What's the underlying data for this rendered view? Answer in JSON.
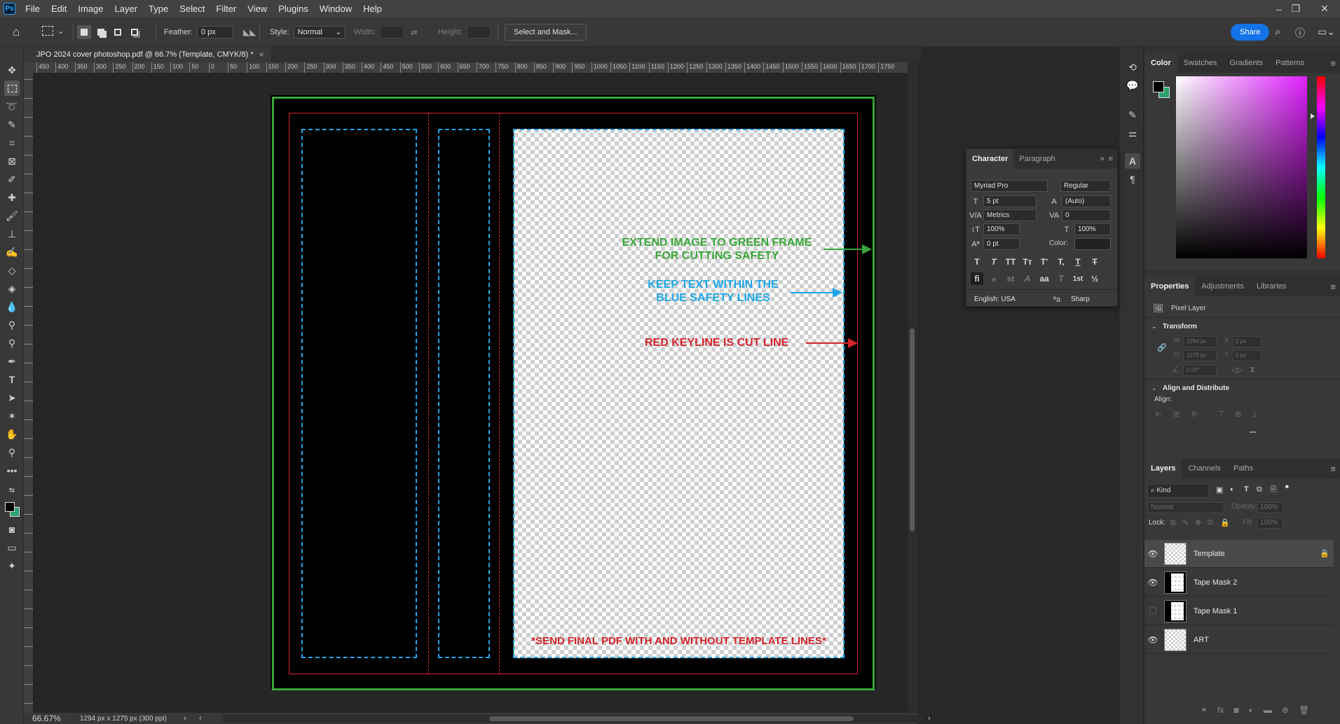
{
  "menubar": {
    "logo": "Ps",
    "items": [
      "File",
      "Edit",
      "Image",
      "Layer",
      "Type",
      "Select",
      "Filter",
      "View",
      "Plugins",
      "Window",
      "Help"
    ],
    "minimize": "–",
    "restore": "❐",
    "close": "✕"
  },
  "options": {
    "feather_label": "Feather:",
    "feather_value": "0 px",
    "style_label": "Style:",
    "style_value": "Normal",
    "width_label": "Width:",
    "height_label": "Height:",
    "select_mask": "Select and Mask...",
    "share": "Share"
  },
  "document": {
    "tab_title": "JPO 2024 cover photoshop.pdf @ 66.7% (Template, CMYK/8) *",
    "zoom": "66.67%",
    "doc_info": "1294 px x 1275 px (300 ppi)",
    "ruler_labels": [
      "450",
      "400",
      "350",
      "300",
      "250",
      "200",
      "150",
      "100",
      "50",
      "0",
      "50",
      "100",
      "150",
      "200",
      "250",
      "300",
      "350",
      "400",
      "450",
      "500",
      "550",
      "600",
      "650",
      "700",
      "750",
      "800",
      "850",
      "900",
      "950",
      "1000",
      "1050",
      "1100",
      "1150",
      "1200",
      "1250",
      "1300",
      "1350",
      "1400",
      "1450",
      "1500",
      "1550",
      "1600",
      "1650",
      "1700",
      "1750"
    ]
  },
  "canvas": {
    "note_green": [
      "EXTEND IMAGE TO GREEN FRAME",
      "FOR CUTTING SAFETY"
    ],
    "note_blue": [
      "KEEP TEXT WITHIN THE",
      "BLUE SAFETY LINES"
    ],
    "note_red": "RED KEYLINE IS CUT LINE",
    "note_bottom": "*SEND FINAL PDF WITH AND WITHOUT TEMPLATE LINES*",
    "colors": {
      "green": "#3aa63a",
      "blue": "#1ea7e8",
      "red": "#d4232c"
    }
  },
  "character": {
    "tab_character": "Character",
    "tab_paragraph": "Paragraph",
    "font_family": "Myriad Pro",
    "font_style": "Regular",
    "size": "5 pt",
    "leading": "(Auto)",
    "kerning": "Metrics",
    "tracking": "0",
    "vscale": "100%",
    "hscale": "100%",
    "baseline": "0 pt",
    "color_label": "Color:",
    "language": "English: USA",
    "aa_icon": "ªa",
    "antialias": "Sharp",
    "style_buttons": [
      "T",
      "T",
      "TT",
      "Tт",
      "T'",
      "T,",
      "T",
      "T"
    ],
    "opentype_buttons": [
      "fi",
      "ℴ",
      "st",
      "A",
      "aa",
      "T",
      "1st",
      "½"
    ]
  },
  "color_panel": {
    "tabs": [
      "Color",
      "Swatches",
      "Gradients",
      "Patterns"
    ],
    "foreground": "#000000",
    "background": "#2aa36e"
  },
  "properties": {
    "tabs": [
      "Properties",
      "Adjustments",
      "Libraries"
    ],
    "kind": "Pixel Layer",
    "transform_label": "Transform",
    "w_label": "W",
    "w_value": "1294 px",
    "h_label": "H",
    "h_value": "1275 px",
    "x_label": "X",
    "x_value": "0 px",
    "y_label": "Y",
    "y_value": "0 px",
    "angle_value": "0.00°",
    "align_distribute_label": "Align and Distribute",
    "align_label": "Align:",
    "more": "..."
  },
  "layers": {
    "tabs": [
      "Layers",
      "Channels",
      "Paths"
    ],
    "filter_kind": "Kind",
    "blend_mode": "Normal",
    "opacity_label": "Opacity:",
    "opacity_value": "100%",
    "lock_label": "Lock:",
    "fill_label": "Fill:",
    "fill_value": "100%",
    "items": [
      {
        "name": "Template",
        "visible": true,
        "locked": true,
        "selected": true,
        "thumb": "transparent"
      },
      {
        "name": "Tape Mask 2",
        "visible": true,
        "locked": false,
        "selected": false,
        "thumb": "mask"
      },
      {
        "name": "Tape Mask 1",
        "visible": false,
        "locked": false,
        "selected": false,
        "thumb": "mask"
      },
      {
        "name": "ART",
        "visible": true,
        "locked": false,
        "selected": false,
        "thumb": "transparent"
      }
    ]
  }
}
